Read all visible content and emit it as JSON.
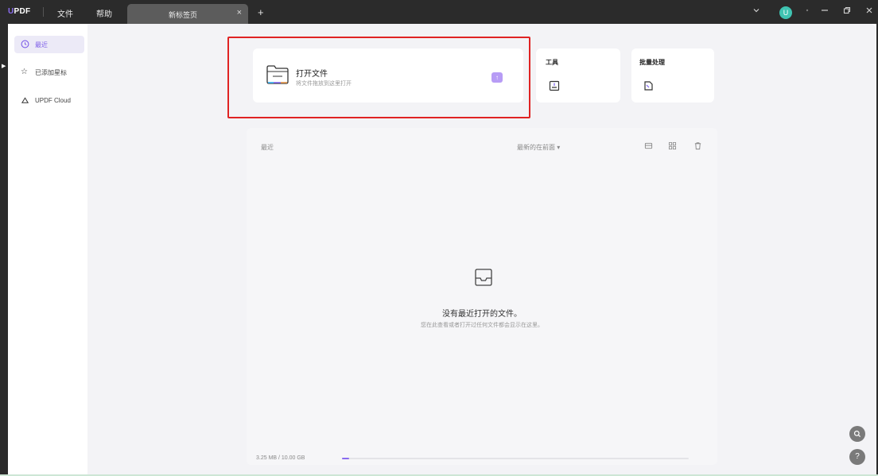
{
  "titlebar": {
    "logo": "UPDF",
    "menus": [
      "文件",
      "帮助"
    ],
    "tab_label": "新标签页",
    "tab_close": "×",
    "tab_add": "+",
    "avatar_initial": "U",
    "icons": [
      "chevron-down-icon",
      "bell-icon",
      "minimize-icon",
      "restore-icon",
      "close-icon"
    ]
  },
  "sidebar": {
    "items": [
      {
        "label": "最近",
        "icon": "clock-icon",
        "active": true
      },
      {
        "label": "已添加星标",
        "icon": "star-icon",
        "active": false
      },
      {
        "label": "UPDF Cloud",
        "icon": "cloud-icon",
        "active": false
      }
    ]
  },
  "open_file": {
    "title": "打开文件",
    "subtitle": "将文件拖放到这里打开"
  },
  "cards": {
    "tools_title": "工具",
    "batch_title": "批量处理"
  },
  "recent": {
    "title": "最近",
    "sort_label": "最新的在前面",
    "empty_title": "没有最近打开的文件。",
    "empty_subtitle": "您在此查看或者打开过任何文件都会显示在这里。"
  },
  "storage": {
    "text": "3.25 MB / 10.00 GB",
    "used_fraction": 0.02
  },
  "colors": {
    "accent": "#8a6cf0",
    "highlight": "#e02323"
  }
}
